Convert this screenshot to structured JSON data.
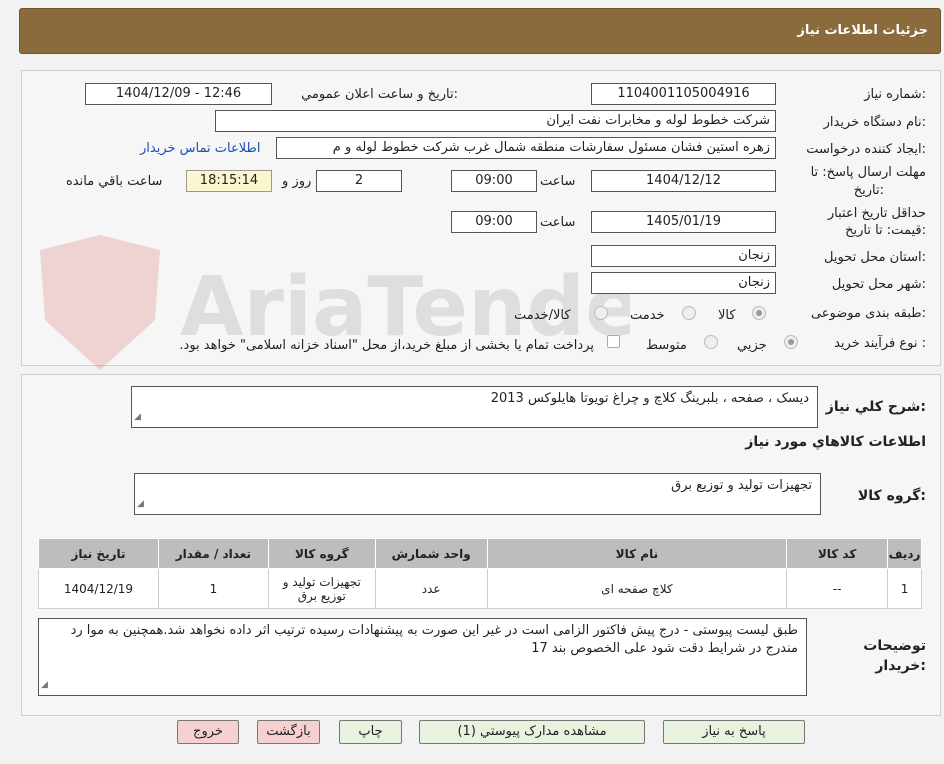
{
  "header": {
    "title": "جزئيات اطلاعات نياز"
  },
  "watermark": {
    "text": "AriaTender.neT"
  },
  "form": {
    "need_number_label": "شماره نياز:",
    "need_number": "1104001105004916",
    "announce_label": "تاريخ و ساعت اعلان عمومي:",
    "announce_value": "1404/12/09 - 12:46",
    "buyer_org_label": "نام دستگاه خريدار:",
    "buyer_org": "شرکت خطوط لوله و مخابرات نفت ايران",
    "requester_label": "ايجاد کننده درخواست:",
    "requester": "زهره استين فشان مسئول سفارشات منطقه شمال غرب شرکت خطوط لوله و م",
    "contact_link": "اطلاعات تماس خريدار",
    "deadline_label_1": "مهلت ارسال پاسخ: تا",
    "deadline_label_2": "تاريخ:",
    "deadline_date": "1404/12/12",
    "time_label": "ساعت",
    "deadline_time": "09:00",
    "days_value": "2",
    "days_label": "روز و",
    "remaining_time": "18:15:14",
    "remaining_label": "ساعت باقي مانده",
    "validity_label_1": "حداقل تاريخ اعتبار",
    "validity_label_2": "قيمت: تا تاريخ:",
    "validity_date": "1405/01/19",
    "validity_time_label": "ساعت",
    "validity_time": "09:00",
    "province_label": "استان محل تحويل:",
    "province": "زنجان",
    "city_label": "شهر محل تحويل:",
    "city": "زنجان",
    "category_label": "طبقه بندی موضوعی:",
    "category_options": [
      "کالا",
      "خدمت",
      "کالا/خدمت"
    ],
    "process_label": "نوع فرآيند خريد :",
    "process_options": [
      "جزيي",
      "متوسط"
    ],
    "process_note": "پرداخت تمام يا بخشی از مبلغ خريد،از محل \"اسناد خزانه اسلامی\" خواهد بود."
  },
  "details": {
    "summary_label": "شرح کلي نياز:",
    "summary": "ديسک ، صفحه ، بلبرينگ کلاچ و چراغ تويوتا هايلوکس 2013",
    "goods_info_title": "اطلاعات کالاهاي مورد نياز",
    "group_label": "گروه کالا:",
    "group_value": "تجهيزات توليد و توزيع برق"
  },
  "table": {
    "headers": [
      "رديف",
      "کد کالا",
      "نام کالا",
      "واحد شمارش",
      "گروه کالا",
      "تعداد / مقدار",
      "تاريخ نياز"
    ],
    "rows": [
      [
        "1",
        "--",
        "کلاچ صفحه ای",
        "عدد",
        "تجهيزات توليد و توزيع برق",
        "1",
        "1404/12/19"
      ]
    ]
  },
  "notes": {
    "label_1": "توضيحات",
    "label_2": "خريدار:",
    "text": "طبق ليست پيوستی - درج پيش فاکتور الزامی است در غير اين صورت به پيشنهادات رسيده ترتيب اثر داده نخواهد شد.همچنين به موا رد مندرج در شرايط دقت شود علی الخصوص بند 17"
  },
  "buttons": {
    "reply": "پاسخ به نياز",
    "attachments": "مشاهده مدارک پيوستي (1)",
    "print": "چاپ",
    "back": "بازگشت",
    "exit": "خروج"
  },
  "colors": {
    "header_bg": "#8b6a3c",
    "link": "#1a4fb3",
    "remaining_bg": "#fbf6cd"
  }
}
